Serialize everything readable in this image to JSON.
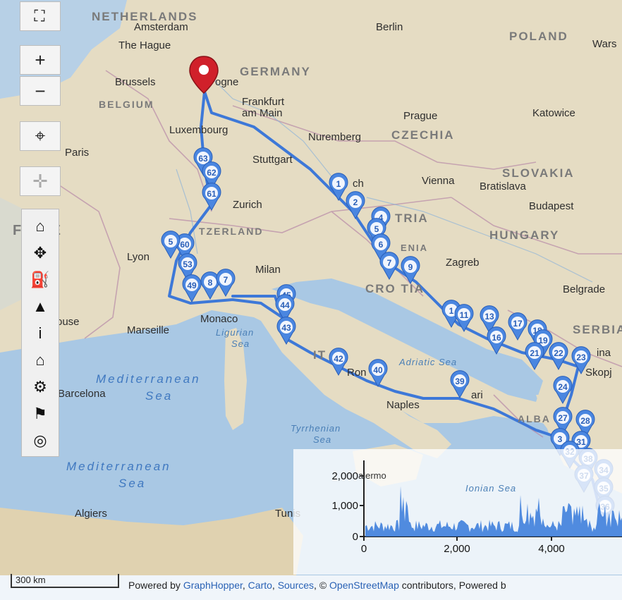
{
  "toolbar": {
    "fullscreen_icon": "fullscreen-icon",
    "zoom_in_label": "+",
    "zoom_out_label": "−",
    "locate_icon": "crosshair-icon",
    "measure_icon": "measure-icon"
  },
  "poi_toolbar": {
    "icons": [
      "home-icon",
      "resize-icon",
      "fuel-icon",
      "mountain-icon",
      "info-icon",
      "museum-icon",
      "settings-icon",
      "flag-icon",
      "binoculars-icon"
    ],
    "glyphs": [
      "⌂",
      "✥",
      "⛽",
      "▲",
      "i",
      "⌂",
      "⚙",
      "⚑",
      "◎"
    ]
  },
  "places": {
    "netherlands": "NETHERLANDS",
    "amsterdam": "Amsterdam",
    "the_hague": "The Hague",
    "berlin": "Berlin",
    "poland": "POLAND",
    "warsaw": "Wars",
    "brussels": "Brussels",
    "cologne": "ogne",
    "germany": "GERMANY",
    "belgium": "BELGIUM",
    "frankfurt": "Frankfurt",
    "frankfurt2": "am Main",
    "prague": "Prague",
    "katowice": "Katowice",
    "czechia": "CZECHIA",
    "luxembourg": "Luxembourg",
    "nuremberg": "Nuremberg",
    "paris": "Paris",
    "stuttgart": "Stuttgart",
    "slovakia": "SLOVAKIA",
    "munich": "ch",
    "vienna": "Vienna",
    "bratislava": "Bratislava",
    "budapest": "Budapest",
    "zurich": "Zurich",
    "austria": "TRIA",
    "france": "F NCE",
    "switzerland": "TZERLAND",
    "hungary": "HUNGARY",
    "lyon": "Lyon",
    "slovenia": "ENIA",
    "zagreb": "Zagreb",
    "milan": "Milan",
    "croatia": "CRO TIA",
    "belgrade": "Belgrade",
    "toulouse": "ouse",
    "monaco": "Monaco",
    "marseille": "Marseille",
    "ligurian": "Ligurian",
    "ligurian2": "Sea",
    "serbia": "SERBIA",
    "italy": "IT",
    "adriatic": "Adriatic Sea",
    "sofia": "ina",
    "rome": "Ron",
    "bari": "ari",
    "skopje": "Skopj",
    "mediterranean1": "Mediterranean",
    "sea1": "Sea",
    "barcelona": "Barcelona",
    "naples": "Naples",
    "albania": "ALBA",
    "tyrrhenian": "Tyrrhenian",
    "tyrrhenian2": "Sea",
    "mediterranean2": "Mediterranean",
    "sea2": "Sea",
    "algiers": "Algiers",
    "tunis": "Tunis",
    "palermo": "alermo",
    "ionian": "Ionian Sea"
  },
  "route_markers": [
    "63",
    "62",
    "61",
    "60",
    "5",
    "53",
    "49",
    "8",
    "7",
    "45",
    "44",
    "43",
    "42",
    "40",
    "39",
    "1",
    "2",
    "4",
    "5",
    "6",
    "7",
    "9",
    "1",
    "11",
    "13",
    "17",
    "18",
    "19",
    "16",
    "21",
    "22",
    "23",
    "24",
    "27",
    "28",
    "3",
    "31",
    "32",
    "38",
    "34",
    "37",
    "35",
    "36"
  ],
  "destination_marker": "destination-pin",
  "elevation_chart": {
    "y_ticks": [
      "2,000",
      "1,000",
      "0"
    ],
    "x_ticks": [
      "0",
      "2,000",
      "4,000"
    ]
  },
  "scale": {
    "label": "300 km"
  },
  "attribution": {
    "prefix": "Powered by ",
    "graphhopper": "GraphHopper",
    "sep1": ", ",
    "carto": "Carto",
    "sep2": ", ",
    "sources": "Sources",
    "sep3": ", © ",
    "osm": "OpenStreetMap",
    "suffix": " contributors, Powered b"
  },
  "colors": {
    "route": "#3d78d8",
    "marker": "#4a86e0",
    "destination": "#d0202a",
    "sea": "#a9c8e4",
    "land": "#e6dcc4"
  }
}
